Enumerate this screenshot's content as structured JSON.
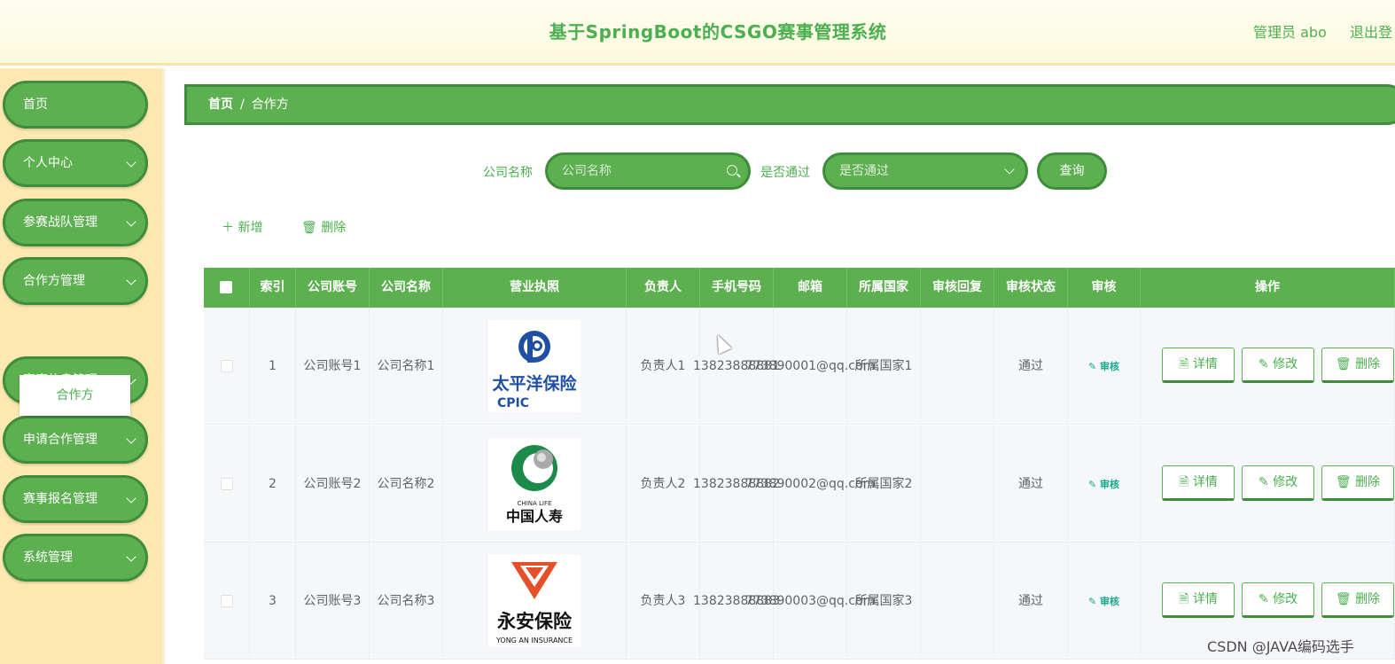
{
  "header": {
    "title": "基于SpringBoot的CSGO赛事管理系统",
    "user": "管理员 abo",
    "logout": "退出登"
  },
  "sidebar": {
    "items": [
      {
        "label": "首页",
        "has_children": false
      },
      {
        "label": "个人中心",
        "has_children": true
      },
      {
        "label": "参赛战队管理",
        "has_children": true
      },
      {
        "label": "合作方管理",
        "has_children": true
      },
      {
        "label": "赛事信息管理",
        "has_children": true
      },
      {
        "label": "申请合作管理",
        "has_children": true
      },
      {
        "label": "赛事报名管理",
        "has_children": true
      },
      {
        "label": "系统管理",
        "has_children": true
      }
    ],
    "active_submenu": "合作方"
  },
  "breadcrumb": {
    "home": "首页",
    "separator": "/",
    "current": "合作方"
  },
  "search": {
    "company_label": "公司名称",
    "company_placeholder": "公司名称",
    "approved_label": "是否通过",
    "approved_placeholder": "是否通过",
    "query_button": "查询"
  },
  "toolbar": {
    "add": "新增",
    "delete": "删除"
  },
  "table": {
    "columns": [
      "索引",
      "公司账号",
      "公司名称",
      "营业执照",
      "负责人",
      "手机号码",
      "邮箱",
      "所属国家",
      "审核回复",
      "审核状态",
      "审核",
      "操作"
    ],
    "audit_link": "审核",
    "actions": {
      "detail": "详情",
      "edit": "修改",
      "delete": "删除"
    },
    "rows": [
      {
        "index": "1",
        "account": [
          "公司账号",
          "1"
        ],
        "name": [
          "公司名称",
          "1"
        ],
        "logo": "太平洋保险 CPIC",
        "manager": "负责人1",
        "phone": [
          "1382388",
          "8881"
        ],
        "email": [
          "7738900",
          "01@qq.",
          "com"
        ],
        "country": [
          "所属国家",
          "1"
        ],
        "reply": "",
        "status": "通过"
      },
      {
        "index": "2",
        "account": [
          "公司账号",
          "2"
        ],
        "name": [
          "公司名称",
          "2"
        ],
        "logo": "CHINA LIFE 中国人寿",
        "manager": "负责人2",
        "phone": [
          "1382388",
          "8882"
        ],
        "email": [
          "7738900",
          "02@qq.",
          "com"
        ],
        "country": [
          "所属国家",
          "2"
        ],
        "reply": "",
        "status": "通过"
      },
      {
        "index": "3",
        "account": [
          "公司账号",
          "3"
        ],
        "name": [
          "公司名称",
          "3"
        ],
        "logo": "永安保险 YONG AN INSURANCE",
        "manager": "负责人3",
        "phone": [
          "1382388",
          "8883"
        ],
        "email": [
          "7738900",
          "03@qq.",
          "com"
        ],
        "country": [
          "所属国家",
          "3"
        ],
        "reply": "",
        "status": "通过"
      }
    ]
  },
  "watermark": "CSDN @JAVA编码选手",
  "colors": {
    "primary": "#5db04f",
    "primary_dark": "#3f8c3a",
    "sidebar_bg": "#fde8b2",
    "header_bg": "#fbf9dc",
    "link": "#1aa98c"
  }
}
